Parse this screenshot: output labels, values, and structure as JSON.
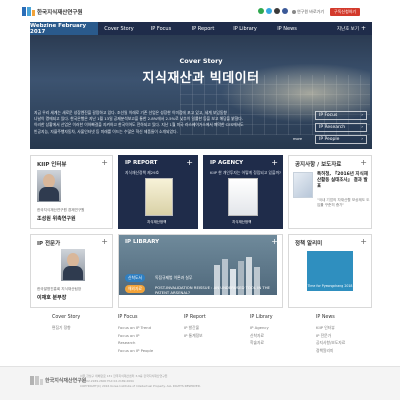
{
  "header": {
    "org_name": "한국지식재산연구원",
    "links": [
      {
        "label": "연구원 바로가기"
      },
      {
        "label": "구독신청하기"
      }
    ],
    "social_icons": [
      "blog-icon",
      "twitter-icon",
      "youtube-icon",
      "facebook-icon"
    ]
  },
  "nav": {
    "brand": "Webzine February 2017",
    "items": [
      "Cover Story",
      "IP Focus",
      "IP Report",
      "IP Library",
      "IP News"
    ],
    "archive": "지난호 보기"
  },
  "hero": {
    "label": "Cover Story",
    "title": "지식재산과 빅데이터",
    "desc_lines": [
      "지금 우리 세계는 새로운 성장엔진을 갈망하고 있다. 조선일 이래로 기존 선업은 성장한 이미점에 포고 있고, 세계 보잉동향",
      "나날이 명에되고 있다. 한국은행은 지난 1월 13일 공제분석보고을 통한 2.8%에서 2.5%로 낮추이 일률한 등을 보고 해당을 밝혔다.",
      "이러한 상황에서 산업은 이러한 이하빠걸을 지켜하고 한국이어도 전하되고 있다. 지난 1월 미국 라스베이거스에서 폐막한 CES에서도",
      "빈공지능, 자율주행자동차, 사물인터넷 등 미래를 이드는 수많은 혁신 제품들이 소개되었다."
    ],
    "links": [
      "IP Focus",
      "IP Research",
      "IP People"
    ],
    "more": "more"
  },
  "cards": {
    "interview": {
      "title": "KIIP 인터뷰",
      "org": "한국지식재산연구원 경제연구원",
      "name": "조성원 위촉연구원"
    },
    "report": {
      "title": "IP REPORT",
      "caption": "지식재산정책 제29호",
      "footer": "지식재산정책"
    },
    "agency": {
      "title": "IP AGENCY",
      "caption": "KIIP 한 개인투자는 어떻게 정립되고 있을까?",
      "footer": "지식재산정책"
    },
    "notice": {
      "title": "공지사항 / 보도자료",
      "headline": "특허청, 『2016년 지식재산활동 실태조사』 결과 발표",
      "sub": "\"국내 기업의 자재산활 보상제도 도입률 꾸준히 증가\""
    },
    "expert": {
      "title": "IP 전문가",
      "org": "한국발명진흥회 지식재산팀장",
      "name": "이재호 분부장"
    },
    "library": {
      "title": "IP LIBRARY",
      "tag1": "신착도서",
      "text1": "독점규제법 이론과 실무",
      "tag2": "해외자료",
      "text2": "POST-INVALIDATION REISSUE : AN UNDERUSED TOOL IN THE PATENT ARSENAL?"
    },
    "policy": {
      "title": "정책 알리미",
      "banner_text": "Time for Pyeongchang 2018"
    }
  },
  "footer": {
    "columns": [
      {
        "title": "Cover Story",
        "items": [
          "편집기 정향"
        ]
      },
      {
        "title": "IP Focus",
        "items": [
          "Focus on IP Trend",
          "Focus on IP Research",
          "Focus on IP People"
        ]
      },
      {
        "title": "IP Report",
        "items": [
          "IP 발간물",
          "IP 통계정보"
        ]
      },
      {
        "title": "IP Library",
        "items": [
          "IP Agency",
          "신착자료",
          "학술자료"
        ]
      },
      {
        "title": "IP News",
        "items": [
          "KIIP 인터뷰",
          "IP 전문가",
          "공지사항/보도자료",
          "정책알리미"
        ]
      }
    ],
    "org_name": "한국지식재산연구원",
    "info_lines": [
      "서울 강남구 테헤란로 131 한국지식재산센터 3,9층 한국지식재산연구원",
      "TEL 02.2189.2600  FAX 02.2189.2694",
      "COPYRIGHT(C) 2016 Korea Institute of Intellectual Property. ALL RIGHTS RESERVED."
    ]
  }
}
